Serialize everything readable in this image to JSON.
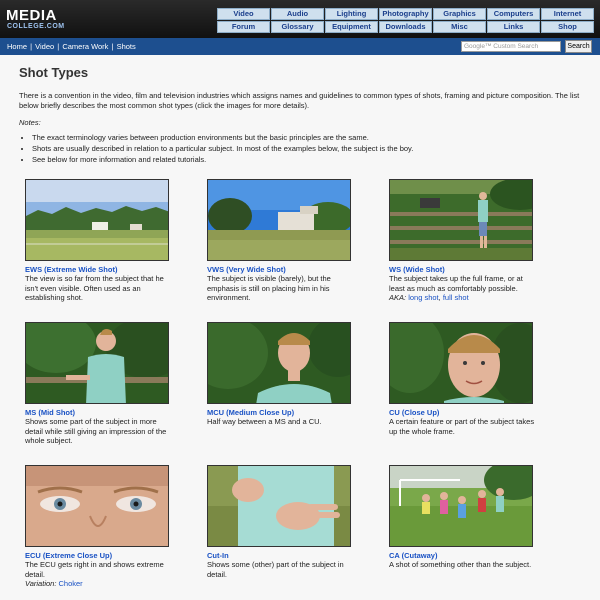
{
  "logo": {
    "main": "MEDIA",
    "sub": "COLLEGE.COM"
  },
  "nav": [
    "Video",
    "Audio",
    "Lighting",
    "Photography",
    "Graphics",
    "Computers",
    "Internet",
    "Forum",
    "Glossary",
    "Equipment",
    "Downloads",
    "Misc",
    "Links",
    "Shop"
  ],
  "breadcrumb": [
    "Home",
    "Video",
    "Camera Work",
    "Shots"
  ],
  "search": {
    "placeholder": "Google™ Custom Search",
    "button": "Search"
  },
  "page_title": "Shot Types",
  "intro": "There is a convention in the video, film and television industries which assigns names and guidelines to common types of shots, framing and picture composition. The list below briefly describes the most common shot types (click the images for more details).",
  "notes_label": "Notes:",
  "notes": [
    "The exact terminology varies between production environments but the basic principles are the same.",
    "Shots are usually described in relation to a particular subject. In most of the examples below, the subject is the boy.",
    "See below for more information and related tutorials."
  ],
  "shots": [
    {
      "title": "EWS (Extreme Wide Shot)",
      "desc": "The view is so far from the subject that he isn't even visible. Often used as an establishing shot."
    },
    {
      "title": "VWS (Very Wide Shot)",
      "desc": "The subject is visible (barely), but the emphasis is still on placing him in his environment."
    },
    {
      "title": "WS (Wide Shot)",
      "desc": "The subject takes up the full frame, or at least as much as comfortably possible.",
      "aka_label": "AKA:",
      "aka_links": [
        "long shot",
        "full shot"
      ]
    },
    {
      "title": "MS (Mid Shot)",
      "desc": "Shows some part of the subject in more detail while still giving an impression of the whole subject."
    },
    {
      "title": "MCU (Medium Close Up)",
      "desc": "Half way between a MS and a CU."
    },
    {
      "title": "CU (Close Up)",
      "desc": "A certain feature or part of the subject takes up the whole frame."
    },
    {
      "title": "ECU (Extreme Close Up)",
      "desc": "The ECU gets right in and shows extreme detail.",
      "variation_label": "Variation:",
      "variation_link": "Choker"
    },
    {
      "title": "Cut-In",
      "desc": "Shows some (other) part of the subject in detail."
    },
    {
      "title": "CA (Cutaway)",
      "desc": "A shot of something other than the subject."
    }
  ]
}
